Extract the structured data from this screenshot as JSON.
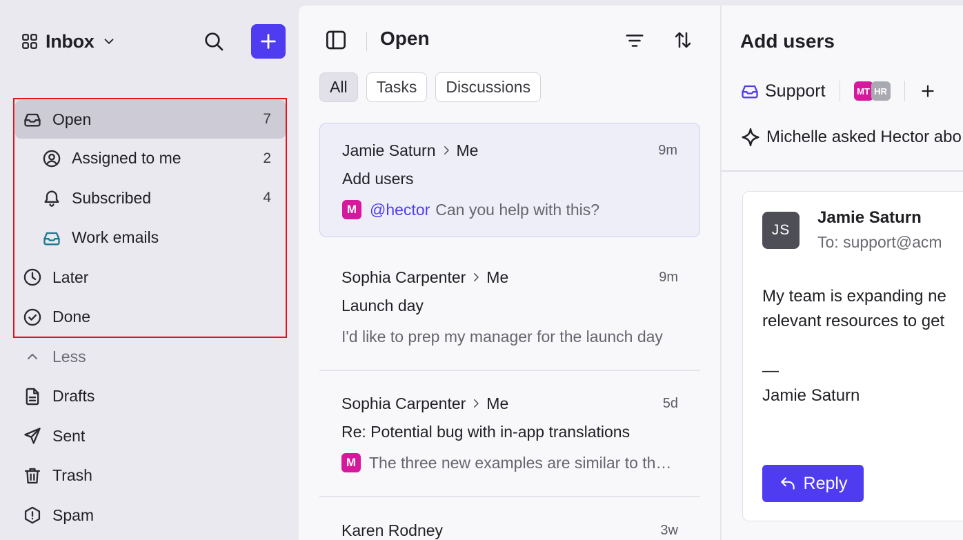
{
  "sidebar": {
    "workspace_title": "Inbox",
    "nav": [
      {
        "label": "Open",
        "count": "7",
        "icon": "inbox-icon",
        "active": true
      },
      {
        "label": "Assigned to me",
        "count": "2",
        "icon": "user-circle-icon"
      },
      {
        "label": "Subscribed",
        "count": "4",
        "icon": "bell-icon"
      },
      {
        "label": "Work emails",
        "count": "",
        "icon": "inbox-teal-icon"
      },
      {
        "label": "Later",
        "count": "",
        "icon": "clock-icon"
      },
      {
        "label": "Done",
        "count": "",
        "icon": "check-circle-icon"
      },
      {
        "label": "Less",
        "count": "",
        "icon": "chevron-up-icon"
      },
      {
        "label": "Drafts",
        "count": "",
        "icon": "document-icon"
      },
      {
        "label": "Sent",
        "count": "",
        "icon": "send-icon"
      },
      {
        "label": "Trash",
        "count": "",
        "icon": "trash-icon"
      },
      {
        "label": "Spam",
        "count": "",
        "icon": "spam-icon"
      }
    ]
  },
  "list": {
    "title": "Open",
    "filters": [
      "All",
      "Tasks",
      "Discussions"
    ],
    "active_filter": "All",
    "conversations": [
      {
        "from": "Jamie Saturn",
        "to": "Me",
        "time": "9m",
        "subject": "Add users",
        "badge": "M",
        "mention": "@hector",
        "preview": "Can you help with this?"
      },
      {
        "from": "Sophia Carpenter",
        "to": "Me",
        "time": "9m",
        "subject": "Launch day",
        "badge": "",
        "mention": "",
        "preview": "I'd like to prep my manager for the launch day"
      },
      {
        "from": "Sophia Carpenter",
        "to": "Me",
        "time": "5d",
        "subject": "Re: Potential bug with in-app translations",
        "badge": "M",
        "mention": "",
        "preview": "The three new examples are similar to the others"
      },
      {
        "from": "Karen Rodney",
        "to": "",
        "time": "3w",
        "subject": "",
        "badge": "",
        "mention": "",
        "preview": ""
      }
    ]
  },
  "detail": {
    "title": "Add users",
    "inbox": "Support",
    "avatars": [
      "MT",
      "HR"
    ],
    "summary": "Michelle asked Hector abo",
    "message": {
      "initials": "JS",
      "from": "Jamie Saturn",
      "to": "To: support@acm",
      "body": [
        "My team is expanding ne",
        "relevant resources to get",
        "",
        "—",
        "Jamie Saturn"
      ],
      "reply_label": "Reply"
    }
  },
  "colors": {
    "accent": "#4f3cf0",
    "mention_badge": "#d6199c",
    "highlight": "#e8101a"
  }
}
